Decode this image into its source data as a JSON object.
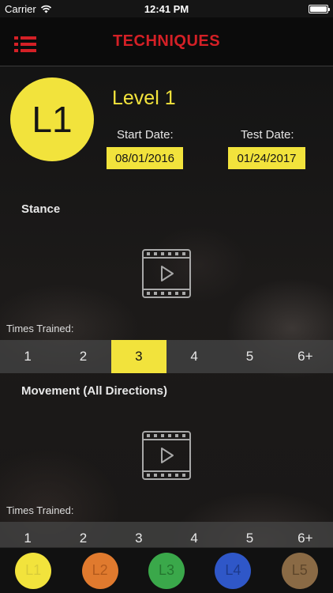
{
  "status_bar": {
    "carrier": "Carrier",
    "time": "12:41 PM"
  },
  "nav": {
    "title": "TECHNIQUES",
    "menu_icon": "list-menu-icon",
    "accent_color": "#d42026"
  },
  "level": {
    "badge": "L1",
    "title": "Level 1",
    "start_date_label": "Start Date:",
    "start_date": "08/01/2016",
    "test_date_label": "Test Date:",
    "test_date": "01/24/2017",
    "color": "#f2e33c"
  },
  "techniques": [
    {
      "title": "Stance",
      "times_label": "Times Trained:",
      "options": [
        "1",
        "2",
        "3",
        "4",
        "5",
        "6+"
      ],
      "selected": "3"
    },
    {
      "title": "Movement (All Directions)",
      "times_label": "Times Trained:",
      "options": [
        "1",
        "2",
        "3",
        "4",
        "5",
        "6+"
      ],
      "selected": null
    }
  ],
  "tabs": [
    {
      "label": "L1",
      "color": "#f2e33c",
      "text_color": "#d8cb3a"
    },
    {
      "label": "L2",
      "color": "#e07a2e",
      "text_color": "#b35a1c"
    },
    {
      "label": "L3",
      "color": "#3aa84a",
      "text_color": "#24762f"
    },
    {
      "label": "L4",
      "color": "#2f57c8",
      "text_color": "#1d3a8c"
    },
    {
      "label": "L5",
      "color": "#8a6a45",
      "text_color": "#5e462b"
    }
  ]
}
